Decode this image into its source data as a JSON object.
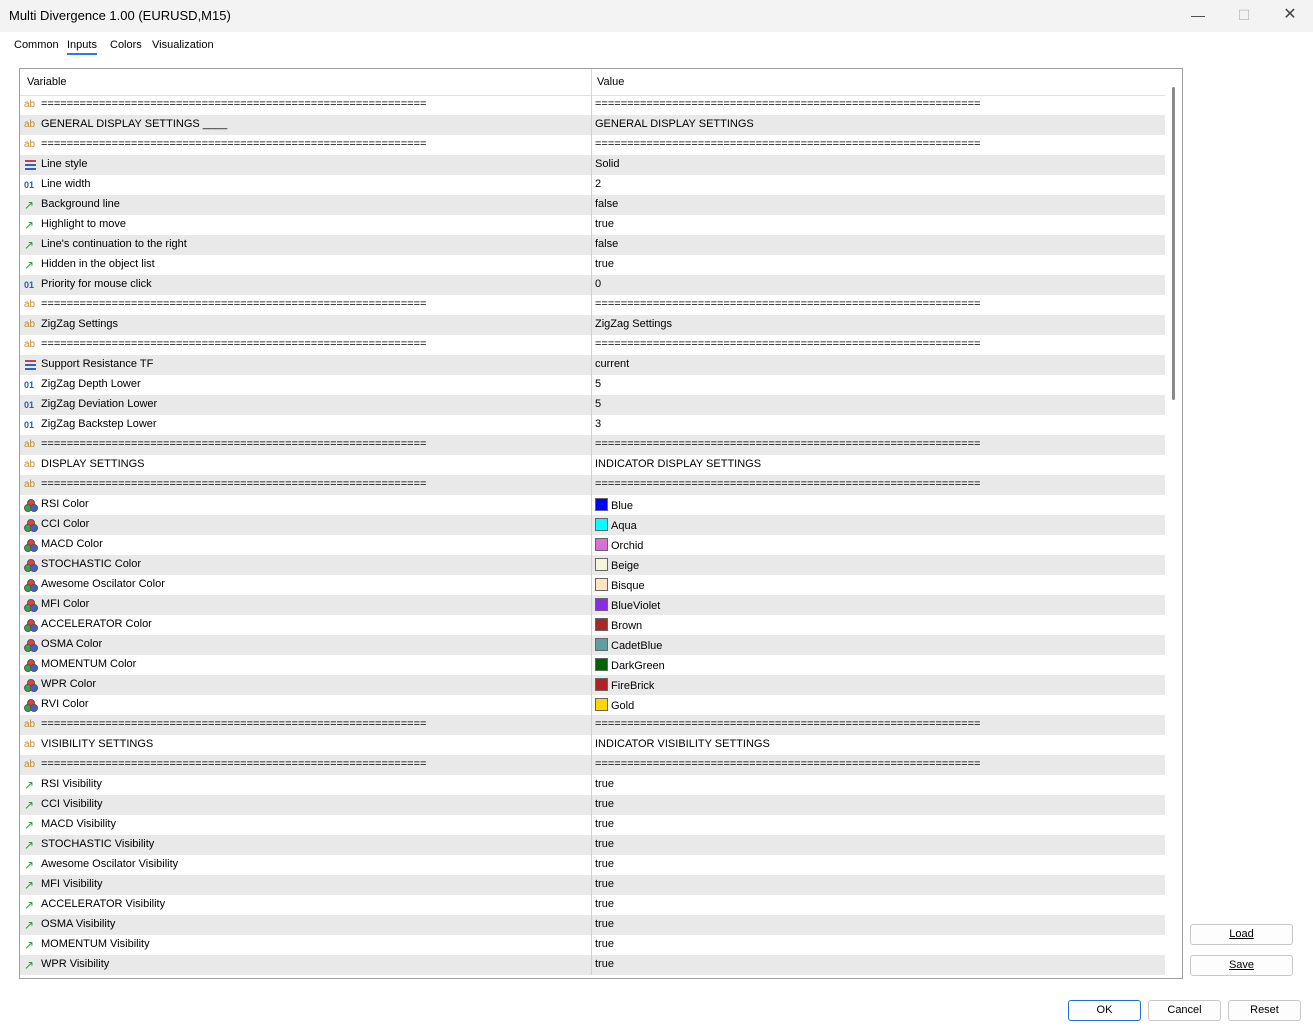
{
  "window": {
    "title": "Multi Divergence 1.00 (EURUSD,M15)"
  },
  "tabs": [
    {
      "label": "Common"
    },
    {
      "label": "Inputs"
    },
    {
      "label": "Colors"
    },
    {
      "label": "Visualization"
    }
  ],
  "grid": {
    "col_variable": "Variable",
    "col_value": "Value",
    "rows": [
      {
        "icon": "ab",
        "var": "============================================================",
        "val": "============================================================"
      },
      {
        "icon": "ab",
        "var": "GENERAL DISPLAY SETTINGS ____",
        "val": "GENERAL DISPLAY SETTINGS"
      },
      {
        "icon": "ab",
        "var": "============================================================",
        "val": "============================================================"
      },
      {
        "icon": "enum",
        "var": "Line style",
        "val": "Solid"
      },
      {
        "icon": "num",
        "var": "Line width",
        "val": "2"
      },
      {
        "icon": "bool",
        "var": "Background line",
        "val": "false"
      },
      {
        "icon": "bool",
        "var": "Highlight to move",
        "val": "true"
      },
      {
        "icon": "bool",
        "var": "Line's continuation to the right",
        "val": "false"
      },
      {
        "icon": "bool",
        "var": "Hidden in the object list",
        "val": "true"
      },
      {
        "icon": "num",
        "var": "Priority for mouse click",
        "val": "0"
      },
      {
        "icon": "ab",
        "var": "============================================================",
        "val": "============================================================"
      },
      {
        "icon": "ab",
        "var": "ZigZag Settings",
        "val": " ZigZag Settings"
      },
      {
        "icon": "ab",
        "var": "============================================================",
        "val": "============================================================"
      },
      {
        "icon": "enum",
        "var": "Support Resistance TF",
        "val": "current"
      },
      {
        "icon": "num",
        "var": "ZigZag Depth Lower",
        "val": "5"
      },
      {
        "icon": "num",
        "var": "ZigZag Deviation Lower",
        "val": "5"
      },
      {
        "icon": "num",
        "var": "ZigZag Backstep Lower",
        "val": "3"
      },
      {
        "icon": "ab",
        "var": "============================================================",
        "val": "============================================================"
      },
      {
        "icon": "ab",
        "var": "DISPLAY SETTINGS",
        "val": "INDICATOR DISPLAY SETTINGS"
      },
      {
        "icon": "ab",
        "var": "============================================================",
        "val": "============================================================"
      },
      {
        "icon": "color",
        "var": "RSI Color",
        "val": "Blue",
        "color": "#0000ff"
      },
      {
        "icon": "color",
        "var": "CCI Color",
        "val": "Aqua",
        "color": "#00ffff"
      },
      {
        "icon": "color",
        "var": "MACD Color",
        "val": "Orchid",
        "color": "#da70d6"
      },
      {
        "icon": "color",
        "var": "STOCHASTIC Color",
        "val": "Beige",
        "color": "#f5f5dc"
      },
      {
        "icon": "color",
        "var": "Awesome Oscilator Color",
        "val": "Bisque",
        "color": "#ffe4c4"
      },
      {
        "icon": "color",
        "var": "MFI Color",
        "val": "BlueViolet",
        "color": "#8a2be2"
      },
      {
        "icon": "color",
        "var": "ACCELERATOR Color",
        "val": "Brown",
        "color": "#a52a2a"
      },
      {
        "icon": "color",
        "var": "OSMA Color",
        "val": "CadetBlue",
        "color": "#5f9ea0"
      },
      {
        "icon": "color",
        "var": "MOMENTUM Color",
        "val": "DarkGreen",
        "color": "#006400"
      },
      {
        "icon": "color",
        "var": "WPR Color",
        "val": "FireBrick",
        "color": "#b22222"
      },
      {
        "icon": "color",
        "var": "RVI Color",
        "val": "Gold",
        "color": "#ffd700"
      },
      {
        "icon": "ab",
        "var": "============================================================",
        "val": "============================================================"
      },
      {
        "icon": "ab",
        "var": "VISIBILITY SETTINGS",
        "val": "INDICATOR VISIBILITY SETTINGS"
      },
      {
        "icon": "ab",
        "var": "============================================================",
        "val": "============================================================"
      },
      {
        "icon": "bool",
        "var": "RSI Visibility",
        "val": "true"
      },
      {
        "icon": "bool",
        "var": "CCI Visibility",
        "val": "true"
      },
      {
        "icon": "bool",
        "var": "MACD Visibility",
        "val": "true"
      },
      {
        "icon": "bool",
        "var": "STOCHASTIC Visibility",
        "val": "true"
      },
      {
        "icon": "bool",
        "var": "Awesome Oscilator Visibility",
        "val": "true"
      },
      {
        "icon": "bool",
        "var": "MFI Visibility",
        "val": "true"
      },
      {
        "icon": "bool",
        "var": "ACCELERATOR Visibility",
        "val": "true"
      },
      {
        "icon": "bool",
        "var": "OSMA Visibility",
        "val": "true"
      },
      {
        "icon": "bool",
        "var": "MOMENTUM Visibility",
        "val": "true"
      },
      {
        "icon": "bool",
        "var": "WPR Visibility",
        "val": "true"
      }
    ]
  },
  "side_buttons": {
    "load": "Load",
    "save": "Save"
  },
  "footer_buttons": {
    "ok": "OK",
    "cancel": "Cancel",
    "reset": "Reset"
  },
  "icons": {
    "ab": "string-type-icon",
    "num": "integer-type-icon",
    "bool": "boolean-type-icon",
    "enum": "enum-type-icon",
    "color": "color-type-icon"
  }
}
